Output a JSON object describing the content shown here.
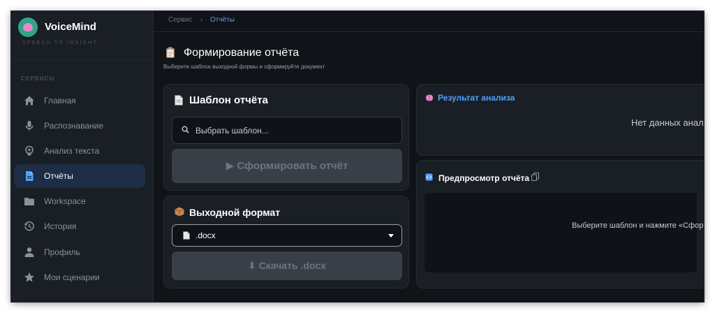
{
  "app": {
    "name": "VoiceMind",
    "tagline": "SPEECH TO INSIGHT"
  },
  "sidebar": {
    "section_label": "СЕРВИСЫ",
    "items": [
      {
        "label": "Главная",
        "icon": "home-icon",
        "active": false
      },
      {
        "label": "Распознавание",
        "icon": "microphone-icon",
        "active": false
      },
      {
        "label": "Анализ текста",
        "icon": "brain-icon",
        "active": false
      },
      {
        "label": "Отчёты",
        "icon": "document-icon",
        "active": true
      },
      {
        "label": "Workspace",
        "icon": "folder-icon",
        "active": false
      },
      {
        "label": "История",
        "icon": "history-icon",
        "active": false
      },
      {
        "label": "Профиль",
        "icon": "person-icon",
        "active": false
      },
      {
        "label": "Мои сценарии",
        "icon": "star-icon",
        "active": false
      }
    ]
  },
  "breadcrumb": {
    "parent": "Сервис",
    "separator": "›",
    "current": "Отчёты"
  },
  "page": {
    "title": "Формирование отчёта",
    "subtitle": "Выберите шаблон выходной формы и сформируйте документ"
  },
  "template_card": {
    "title": "Шаблон отчёта",
    "search_placeholder": "Выбрать шаблон...",
    "generate_label": "▶ Сформировать отчёт"
  },
  "format_card": {
    "title": "Выходной формат",
    "selected": ".docx",
    "download_label": "⬇ Скачать .docx"
  },
  "result_card": {
    "title": "Результат анализа",
    "empty_text": "Нет данных анализа"
  },
  "preview_card": {
    "title": "Предпросмотр отчёта",
    "empty_text": "Выберите шаблон и нажмите «Сформировать отчёт»"
  },
  "colors": {
    "background": "#101318",
    "panel": "#1a1e25",
    "accent": "#4da3ff",
    "active_nav": "#1c2d45",
    "disabled_button": "#3a3f47"
  }
}
